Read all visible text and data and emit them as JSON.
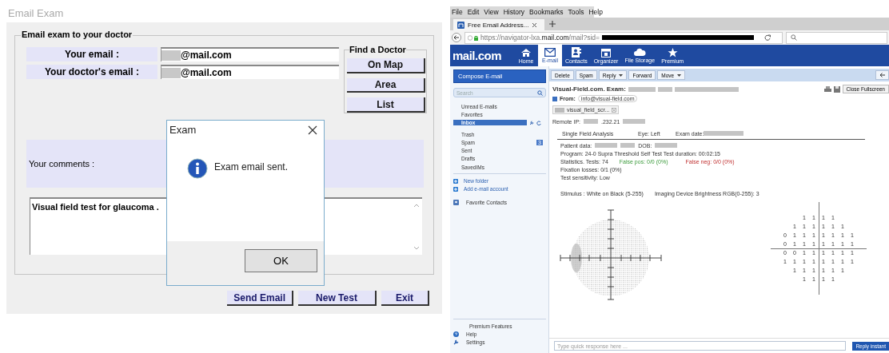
{
  "exam_app": {
    "title": "Email Exam",
    "group_title": "Email exam to your doctor",
    "fields": [
      {
        "label": "Your email :",
        "value": "@mail.com"
      },
      {
        "label": "Your doctor's email :",
        "value": "@mail.com"
      }
    ],
    "find_doctor": {
      "title": "Find a Doctor",
      "buttons": [
        "On Map",
        "Area",
        "List"
      ]
    },
    "comments_label": "Your comments  :",
    "comments_value": "Visual field test for glaucoma .",
    "buttons": [
      "Send Email",
      "New Test",
      "Exit"
    ],
    "dialog": {
      "title": "Exam",
      "message": "Exam email sent.",
      "button": "OK"
    }
  },
  "browser": {
    "menu": [
      "File",
      "Edit",
      "View",
      "History",
      "Bookmarks",
      "Tools",
      "Help"
    ],
    "tab": {
      "title": "Free Email Address..."
    },
    "url_prefix": "https://navigator-lxa.",
    "url_domain": "mail.com",
    "url_path": "/mail?sid=",
    "logo": "mail.com",
    "nav": [
      {
        "label": "Home",
        "kind": "home",
        "selected": false
      },
      {
        "label": "E-mail",
        "kind": "email",
        "selected": true
      },
      {
        "label": "Contacts",
        "kind": "contacts",
        "selected": false
      },
      {
        "label": "Organizer",
        "kind": "organizer",
        "selected": false
      },
      {
        "label": "File Storage",
        "kind": "storage",
        "selected": false
      },
      {
        "label": "Premium",
        "kind": "premium",
        "selected": false
      }
    ],
    "compose": "Compose E-mail",
    "search_placeholder": "Search",
    "folders_top": [
      {
        "label": "Unread E-mails",
        "selected": false
      },
      {
        "label": "Favorites",
        "selected": false
      },
      {
        "label": "Inbox",
        "selected": true
      }
    ],
    "folders": [
      {
        "label": "Trash"
      },
      {
        "label": "Spam",
        "badge": "3"
      },
      {
        "label": "Sent"
      },
      {
        "label": "Drafts"
      },
      {
        "label": "SavedIMs"
      }
    ],
    "actions": [
      "New folder",
      "Add e-mail account"
    ],
    "favorite_contacts": "Favorite Contacts",
    "bottom_links": [
      {
        "label": "Premium Features",
        "kind": "plain"
      },
      {
        "label": "Help",
        "kind": "help"
      },
      {
        "label": "Settings",
        "kind": "settings"
      }
    ],
    "toolbar": [
      {
        "label": "Delete",
        "dropdown": false
      },
      {
        "label": "Spam",
        "dropdown": false
      },
      {
        "label": "Reply",
        "dropdown": true
      },
      {
        "label": "Forward",
        "dropdown": false
      },
      {
        "label": "Move",
        "dropdown": true
      }
    ],
    "message": {
      "subject": "Visual-Field.com. Exam:",
      "from_label": "From:",
      "from": "info@visual-field.com",
      "attachment": "visual_field_scr...",
      "close_fullscreen": "Close Fullscreen",
      "remote_ip_label": "Remote IP:",
      "remote_ip": ".232.21",
      "header": [
        "Single Field Analysis",
        "Eye: Left",
        "Exam date:"
      ],
      "patient_label": "Patient data:",
      "dob_label": "DOB:",
      "program": "Program: 24-0 Supra Threshold Self Test  Test duration: 00:02:15",
      "stats": "Statistics.   Tests: 74",
      "false_pos": "False pos: 0/0 (0%)",
      "false_neg": "False neg: 0/0 (0%)",
      "fixation": "Fixation losses: 0/1 (0%)",
      "sensitivity": "Test sensitivity: Low",
      "stimulus": "Stimulus : White on Black (5-255)",
      "brightness": "Imaging Device Brightness RGB(0-255):  3",
      "grid": [
        [
          "1",
          "1",
          "1",
          "1"
        ],
        [
          "1",
          "1",
          "1",
          "1",
          "1",
          "1"
        ],
        [
          "0",
          "1",
          "1",
          "1",
          "1",
          "1",
          "1",
          "1"
        ],
        [
          "0",
          "1",
          "1",
          "1",
          "1",
          "1",
          "1",
          "1"
        ],
        [
          "0",
          "0",
          "1",
          "1",
          "1",
          "1",
          "1",
          "1"
        ],
        [
          "1",
          "1",
          "1",
          "1",
          "1",
          "1",
          "1",
          "1"
        ],
        [
          "1",
          "1",
          "1",
          "1",
          "1",
          "1"
        ],
        [
          "1",
          "1",
          "1",
          "1"
        ]
      ]
    },
    "quick_reply_placeholder": "Type quick response here ...",
    "reply_button": "Reply instant"
  }
}
